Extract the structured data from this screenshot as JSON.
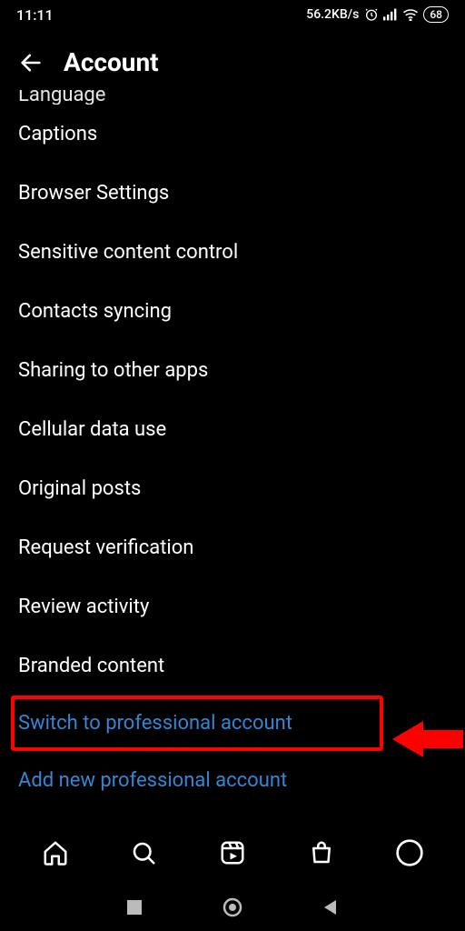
{
  "status": {
    "time": "11:11",
    "net_speed": "56.2KB/s",
    "battery": "68"
  },
  "header": {
    "title": "Account"
  },
  "cutoff_label": "Language",
  "items": [
    "Captions",
    "Browser Settings",
    "Sensitive content control",
    "Contacts syncing",
    "Sharing to other apps",
    "Cellular data use",
    "Original posts",
    "Request verification",
    "Review activity",
    "Branded content"
  ],
  "links": {
    "switch": "Switch to professional account",
    "add": "Add new professional account"
  },
  "colors": {
    "link": "#2f88d6",
    "highlight": "#ff0000"
  }
}
